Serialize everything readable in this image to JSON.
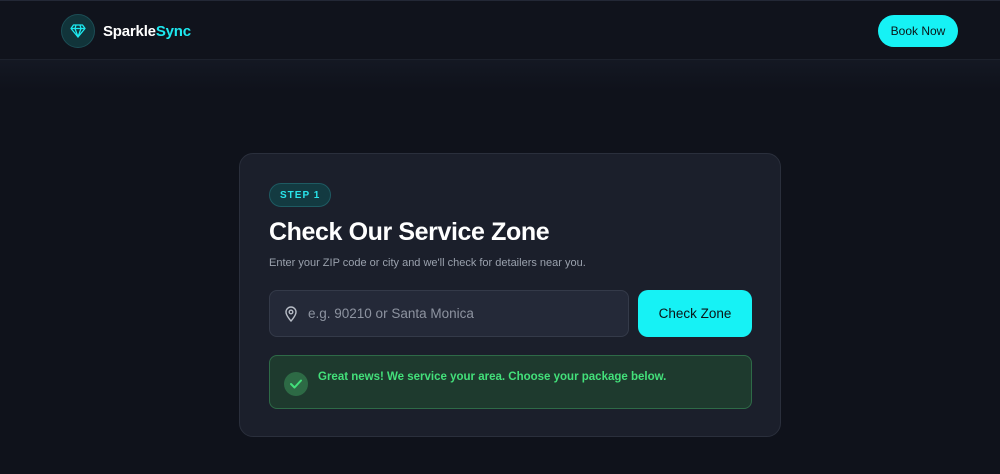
{
  "header": {
    "brand_part1": "Sparkle",
    "brand_part2": "Sync",
    "logo_icon": "diamond-icon",
    "book_label": "Book Now"
  },
  "card": {
    "step_label": "STEP 1",
    "title": "Check Our Service Zone",
    "subtitle": "Enter your ZIP code or city and we'll check for detailers near you.",
    "search": {
      "icon": "map-pin-icon",
      "value": "",
      "placeholder": "e.g. 90210 or Santa Monica"
    },
    "check_label": "Check Zone",
    "success": {
      "icon": "checkmark-icon",
      "message": "Great news! We service your area. Choose your package below."
    }
  },
  "colors": {
    "accent": "#16f2f5",
    "background": "#0f121b",
    "card": "#1b1f2b",
    "success_text": "#43e07a",
    "success_bg": "#1e3a2e"
  }
}
